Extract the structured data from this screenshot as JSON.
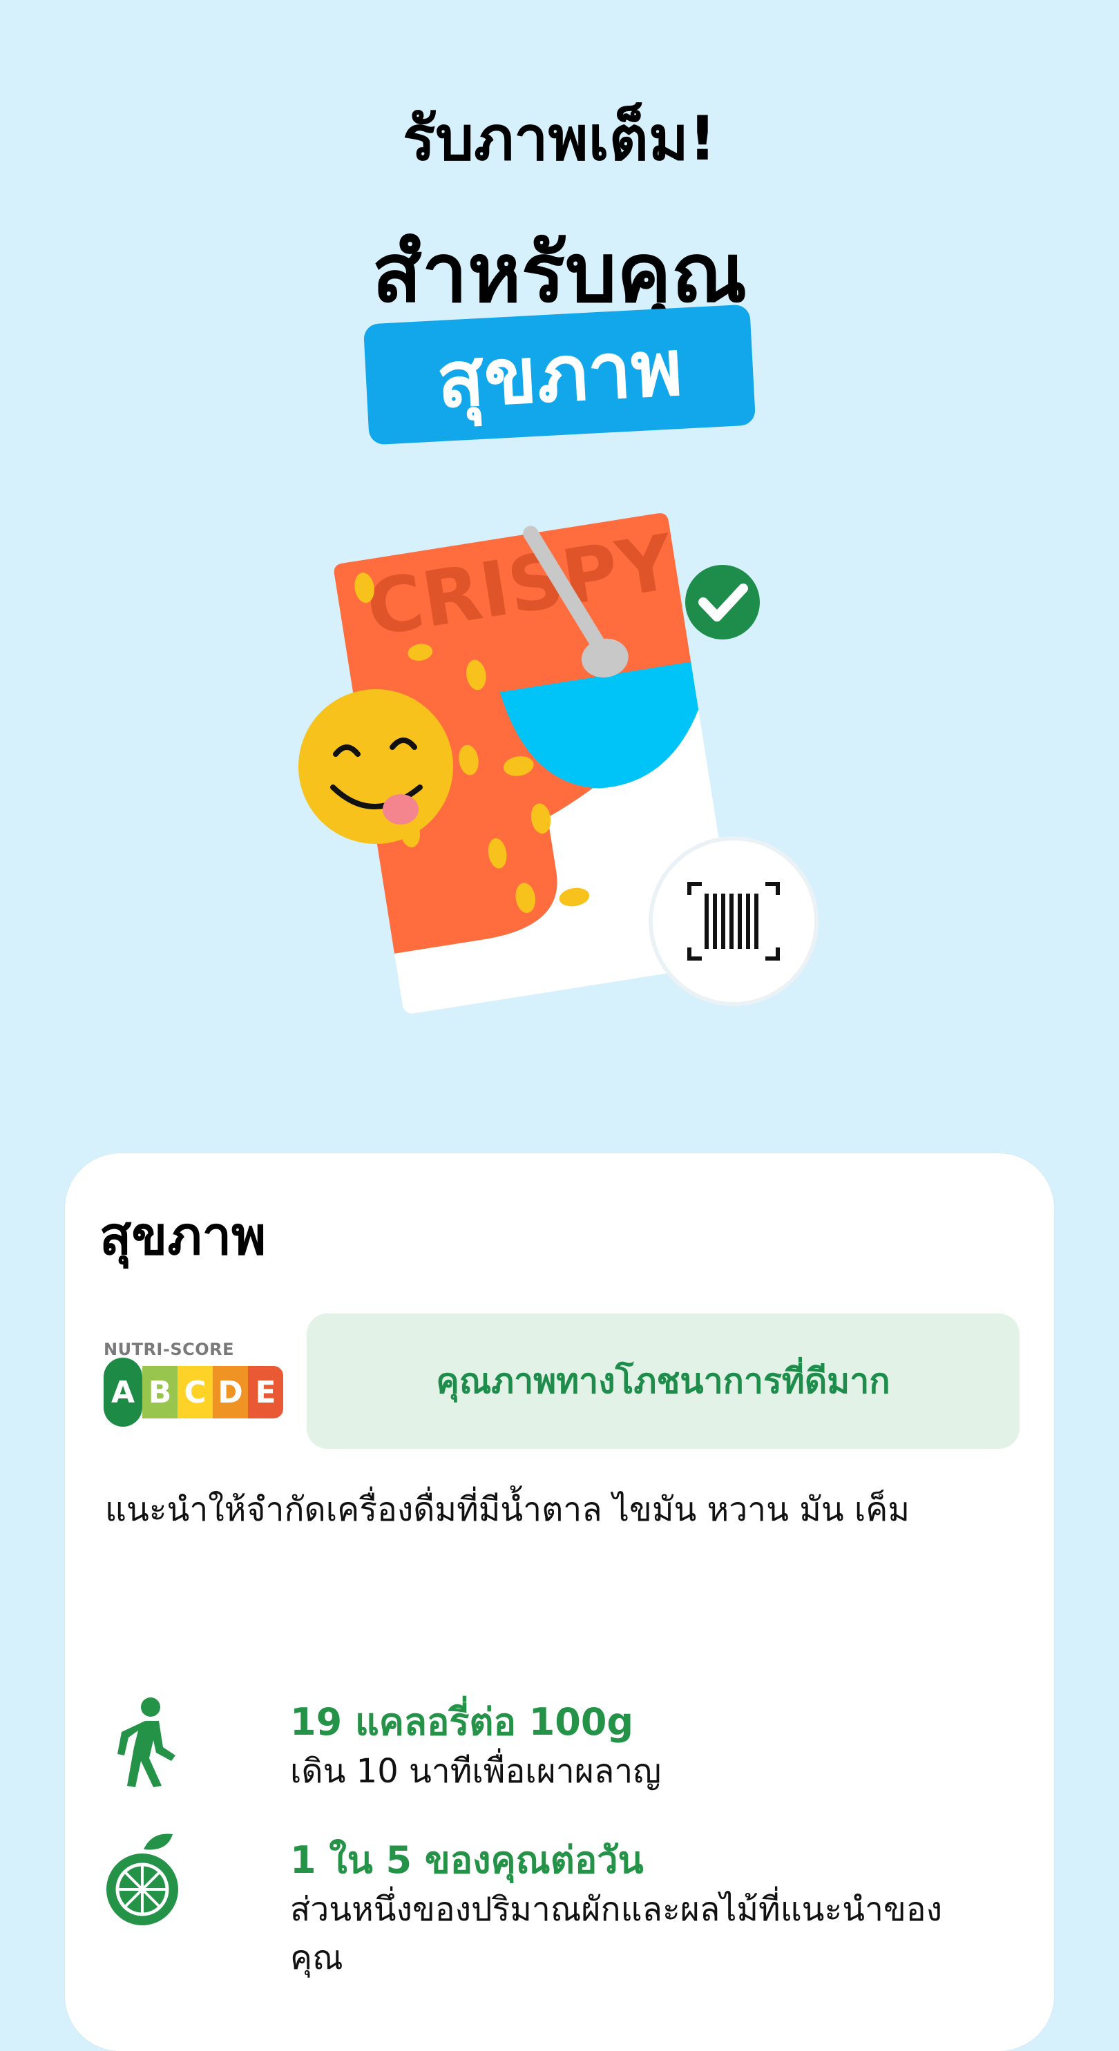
{
  "header": {
    "line1": "รับภาพเต็ม!",
    "line2": "สำหรับคุณ",
    "tag": "สุขภาพ"
  },
  "illustration": {
    "package_text": "CRISPY",
    "icons": [
      "smiley-tongue-icon",
      "check-badge-icon",
      "barcode-scan-icon",
      "spoon-bowl-icon"
    ]
  },
  "card": {
    "title": "สุขภาพ",
    "nutriscore": {
      "label": "NUTRI-SCORE",
      "grades": [
        "A",
        "B",
        "C",
        "D",
        "E"
      ],
      "selected": "A"
    },
    "grade_text": "คุณภาพทางโภชนาการที่ดีมาก",
    "advice": "แนะนำให้จำกัดเครื่องดื่มที่มีน้ำตาล ไขมัน หวาน มัน เค็ม",
    "rows": [
      {
        "icon": "walking-person-icon",
        "title": "19 แคลอรี่ต่อ 100g",
        "subtitle": "เดิน 10 นาทีเพื่อเผาผลาญ"
      },
      {
        "icon": "fruit-icon",
        "title": "1 ใน 5 ของคุณต่อวัน",
        "subtitle": "ส่วนหนึ่งของปริมาณผักและผลไม้ที่แนะนำของคุณ"
      }
    ]
  },
  "colors": {
    "background": "#d6f0fc",
    "accent_blue": "#12a7ea",
    "green": "#1e8c4a"
  }
}
